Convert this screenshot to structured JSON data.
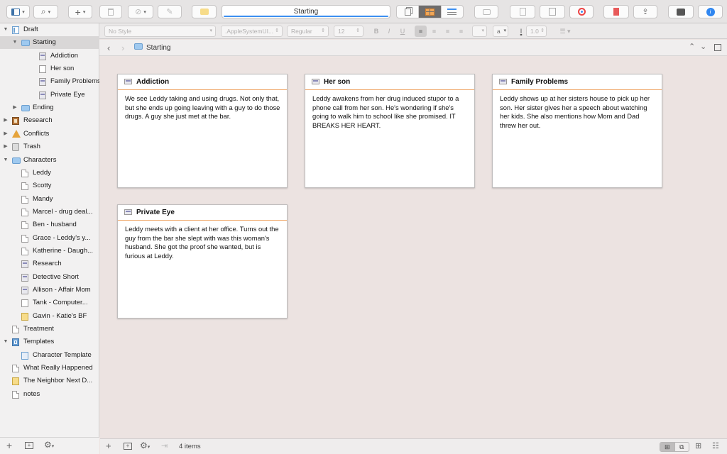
{
  "toolbar": {
    "title_field": "Starting",
    "accent": "#3d8ff1"
  },
  "formatbar": {
    "style": "No Style",
    "font": ".AppleSystemUI...",
    "weight": "Regular",
    "size": "12",
    "line_spacing": "1.0",
    "bold": "B",
    "italic": "I",
    "underline": "U",
    "highlight": "a"
  },
  "header": {
    "title": "Starting"
  },
  "binder": [
    {
      "label": "Draft",
      "icon": "draft-icon",
      "level": 0,
      "triangle": "open"
    },
    {
      "label": "Starting",
      "icon": "folder-icon",
      "level": 1,
      "triangle": "open",
      "selected": true
    },
    {
      "label": "Addiction",
      "icon": "index-card-icon",
      "level": 2
    },
    {
      "label": "Her son",
      "icon": "document-icon",
      "level": 2
    },
    {
      "label": "Family Problems",
      "icon": "index-card-icon",
      "level": 2
    },
    {
      "label": "Private Eye",
      "icon": "index-card-icon",
      "level": 2
    },
    {
      "label": "Ending",
      "icon": "folder-icon",
      "level": 1,
      "triangle": "closed"
    },
    {
      "label": "Research",
      "icon": "research-icon",
      "level": 0,
      "triangle": "closed"
    },
    {
      "label": "Conflicts",
      "icon": "warning-icon",
      "level": 0,
      "triangle": "closed"
    },
    {
      "label": "Trash",
      "icon": "trash-icon",
      "level": 0,
      "triangle": "closed"
    },
    {
      "label": "Characters",
      "icon": "folder-icon",
      "level": 0,
      "triangle": "open"
    },
    {
      "label": "Leddy",
      "icon": "character-icon",
      "level": 1
    },
    {
      "label": "Scotty",
      "icon": "character-icon",
      "level": 1
    },
    {
      "label": "Mandy",
      "icon": "character-icon",
      "level": 1
    },
    {
      "label": "Marcel - drug deal...",
      "icon": "character-icon",
      "level": 1
    },
    {
      "label": "Ben - husband",
      "icon": "character-icon",
      "level": 1
    },
    {
      "label": "Grace - Leddy's y...",
      "icon": "character-icon",
      "level": 1
    },
    {
      "label": "Katherine - Daugh...",
      "icon": "character-icon",
      "level": 1
    },
    {
      "label": "Research",
      "icon": "index-card-icon",
      "level": 1
    },
    {
      "label": "Detective Short",
      "icon": "index-card-icon",
      "level": 1
    },
    {
      "label": "Allison - Affair Mom",
      "icon": "index-card-icon",
      "level": 1
    },
    {
      "label": "Tank - Computer...",
      "icon": "document-icon",
      "level": 1
    },
    {
      "label": "Gavin - Katie's BF",
      "icon": "note-icon",
      "level": 1
    },
    {
      "label": "Treatment",
      "icon": "character-icon",
      "level": 0
    },
    {
      "label": "Templates",
      "icon": "templates-icon",
      "level": 0,
      "triangle": "open"
    },
    {
      "label": "Character Template",
      "icon": "character-template-icon",
      "level": 1
    },
    {
      "label": "What Really Happened",
      "icon": "character-icon",
      "level": 0
    },
    {
      "label": "The Neighbor Next D...",
      "icon": "note-icon",
      "level": 0
    },
    {
      "label": "notes",
      "icon": "character-icon",
      "level": 0
    }
  ],
  "cards": [
    {
      "title": "Addiction",
      "synopsis": "We see Leddy taking and using drugs.  Not only that, but she ends up going leaving with a guy to do those drugs. A guy she just met at the bar."
    },
    {
      "title": "Her son",
      "synopsis": "Leddy awakens from her drug induced stupor to a phone call from her son.  He's wondering if she's going to walk him to school like she promised.  IT BREAKS HER HEART."
    },
    {
      "title": "Family Problems",
      "synopsis": "Leddy shows up at her sisters house to pick up her son.  Her sister gives her a speech about watching her kids.  She also mentions how Mom and Dad threw her out."
    },
    {
      "title": "Private Eye",
      "synopsis": "Leddy meets with a client at her office.  Turns out the guy from the bar she slept with was this woman's husband.  She got the proof she wanted, but is furious at Leddy."
    }
  ],
  "status": {
    "item_count": "4 items"
  },
  "colors": {
    "corkboard_bg": "#ece3e1",
    "card_rule": "#f0a86a"
  }
}
